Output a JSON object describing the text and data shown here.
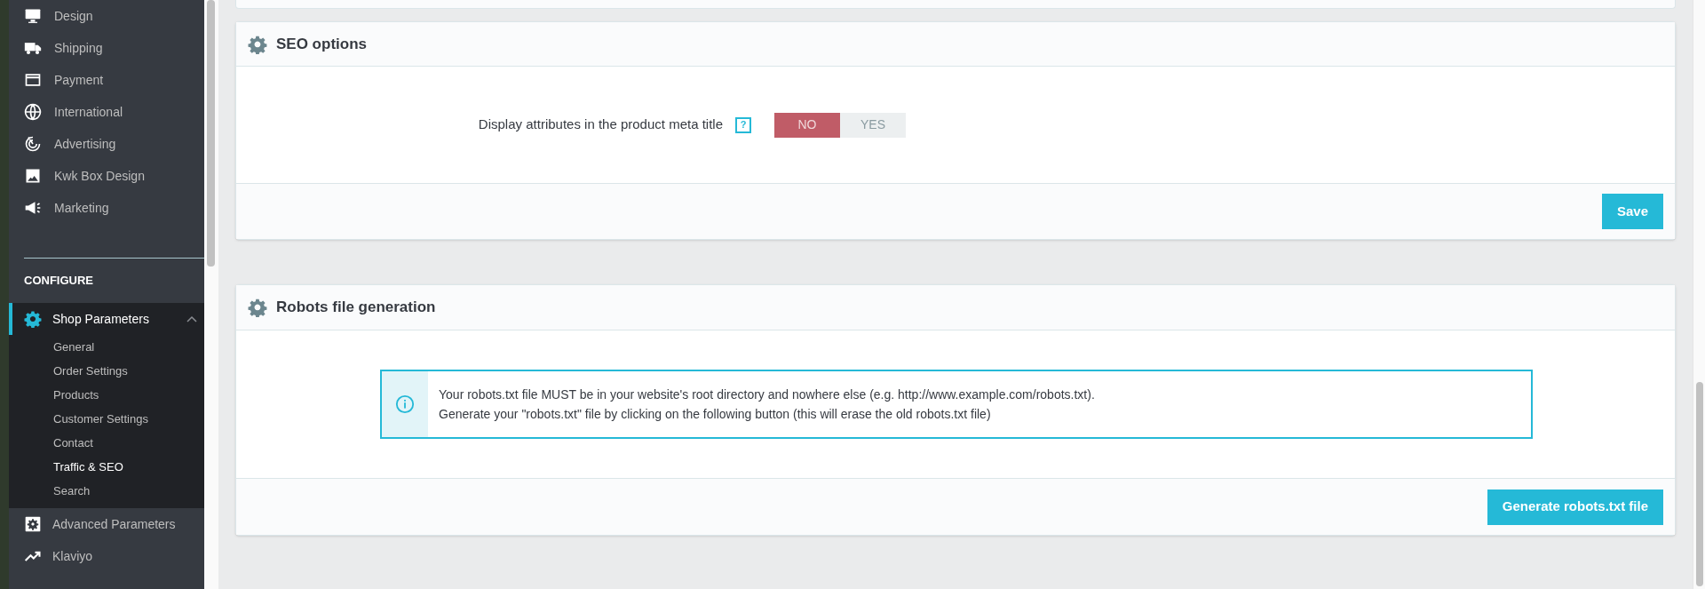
{
  "sidebar": {
    "items": [
      {
        "label": "Design",
        "kind": "monitor"
      },
      {
        "label": "Shipping",
        "kind": "truck"
      },
      {
        "label": "Payment",
        "kind": "card"
      },
      {
        "label": "International",
        "kind": "globe"
      },
      {
        "label": "Advertising",
        "kind": "target"
      },
      {
        "label": "Kwk Box Design",
        "kind": "image"
      },
      {
        "label": "Marketing",
        "kind": "megaphone"
      }
    ],
    "section_title": "CONFIGURE",
    "configure_items": [
      {
        "label": "Shop Parameters",
        "kind": "gear",
        "selected": true,
        "expanded": true,
        "children": [
          {
            "label": "General",
            "selected": false
          },
          {
            "label": "Order Settings",
            "selected": false
          },
          {
            "label": "Products",
            "selected": false
          },
          {
            "label": "Customer Settings",
            "selected": false
          },
          {
            "label": "Contact",
            "selected": false
          },
          {
            "label": "Traffic & SEO",
            "selected": true
          },
          {
            "label": "Search",
            "selected": false
          }
        ]
      },
      {
        "label": "Advanced Parameters",
        "kind": "cogbox",
        "selected": false
      },
      {
        "label": "Klaviyo",
        "kind": "trend",
        "selected": false
      }
    ]
  },
  "seo_panel": {
    "title": "SEO options",
    "field_label": "Display attributes in the product meta title",
    "help": "?",
    "toggle": [
      {
        "label": "NO",
        "selected": true
      },
      {
        "label": "YES",
        "selected": false
      }
    ],
    "save_button": "Save"
  },
  "robots_panel": {
    "title": "Robots file generation",
    "info_lines": [
      "Your robots.txt file MUST be in your website's root directory and nowhere else (e.g. http://www.example.com/robots.txt).",
      "Generate your \"robots.txt\" file by clicking on the following button (this will erase the old robots.txt file)"
    ],
    "button": "Generate robots.txt file"
  }
}
